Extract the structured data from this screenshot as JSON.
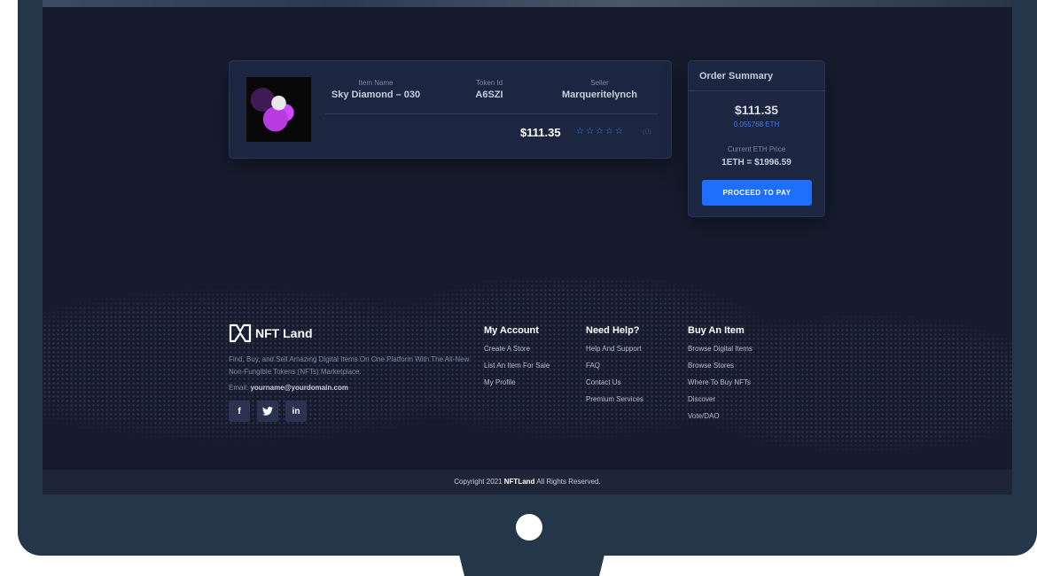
{
  "item": {
    "name_label": "Item Name",
    "name": "Sky Diamond – 030",
    "token_label": "Token Id",
    "token_id": "A6SZI",
    "seller_label": "Seller",
    "seller": "Marqueritelynch",
    "price": "$111.35",
    "rating_stars": 5,
    "rating_count": "(0)"
  },
  "order": {
    "title": "Order Summary",
    "usd": "$111.35",
    "eth": "0.055768 ETH",
    "price_label": "Current ETH Price",
    "rate": "1ETH = $1996.59",
    "proceed_label": "PROCEED TO PAY"
  },
  "footer": {
    "brand": "NFT Land",
    "description": "Find, Buy, and Sell Amazing Digital Items On One Platform With The All-New Non-Fungible Tokens (NFTs) Marketplace.",
    "email_label": "Email: ",
    "email": "yourname@yourdomain.com",
    "social": [
      "f",
      "t",
      "in"
    ],
    "my_account": {
      "title": "My Account",
      "links": [
        "Create A Store",
        "List An Item For Sale",
        "My Profile"
      ]
    },
    "need_help": {
      "title": "Need Help?",
      "links": [
        "Help And Support",
        "FAQ",
        "Contact Us",
        "Premium Services"
      ]
    },
    "buy_item": {
      "title": "Buy An Item",
      "links": [
        "Browse Digital Items",
        "Browse Stores",
        "Where To Buy NFTs",
        "Discover",
        "Vote/DAO"
      ]
    },
    "copyright_pre": "Copyright 2021 ",
    "copyright_brand": "NFTLand",
    "copyright_post": " All Rights Reserved."
  },
  "colors": {
    "accent": "#1f6fff",
    "screen_bg": "#161c2e",
    "card_bg": "#1d2640",
    "monitor": "#24374a"
  }
}
